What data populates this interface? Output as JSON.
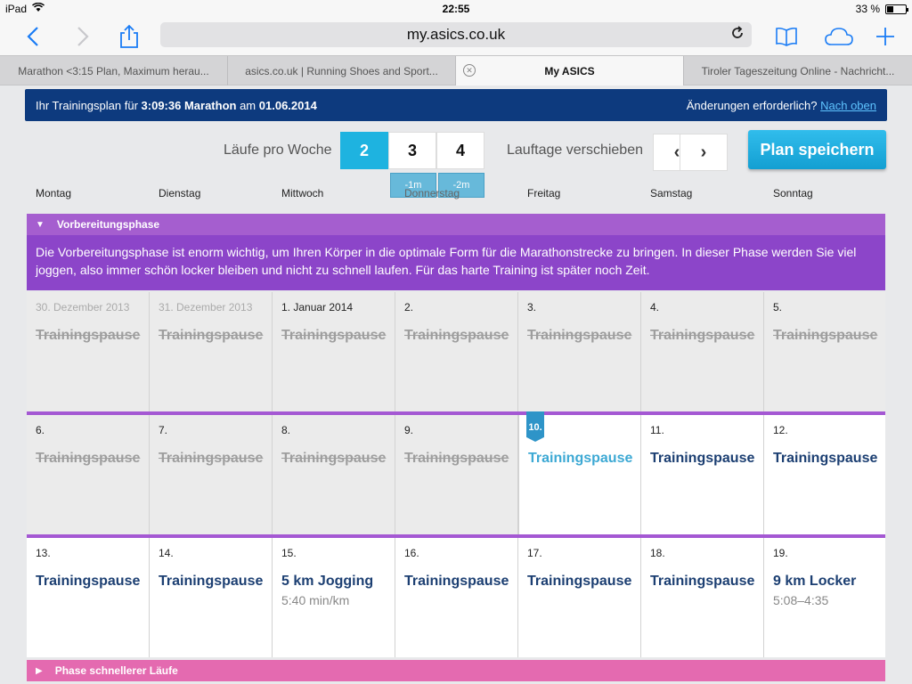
{
  "status": {
    "device": "iPad",
    "time": "22:55",
    "battery": "33 %",
    "battery_level": 0.33
  },
  "browser": {
    "url": "my.asics.co.uk",
    "tabs": [
      {
        "label": "Marathon <3:15 Plan, Maximum herau..."
      },
      {
        "label": "asics.co.uk | Running Shoes and Sport..."
      },
      {
        "label": "My ASICS",
        "active": true
      },
      {
        "label": "Tiroler Tageszeitung Online - Nachricht..."
      }
    ]
  },
  "banner": {
    "prefix": "Ihr Trainingsplan für",
    "time": "3:09:36 Marathon",
    "mid": "am",
    "date": "01.06.2014",
    "change_text": "Änderungen erforderlich?",
    "change_link": "Nach oben"
  },
  "controls": {
    "runs_label": "Läufe pro Woche",
    "runs": [
      "2",
      "3",
      "4"
    ],
    "runs_selected": "2",
    "badges": [
      "-1m",
      "-2m"
    ],
    "shift_label": "Lauftage verschieben",
    "prev": "‹",
    "next": "›",
    "save": "Plan speichern"
  },
  "weekdays": [
    "Montag",
    "Dienstag",
    "Mittwoch",
    "Donnerstag",
    "Freitag",
    "Samstag",
    "Sonntag"
  ],
  "phase1": {
    "title": "Vorbereitungsphase",
    "description": "Die Vorbereitungsphase ist enorm wichtig, um Ihren Körper in die optimale Form für die Marathonstrecke zu bringen. In dieser Phase werden Sie viel joggen, also immer schön locker bleiben und nicht zu schnell laufen. Für das harte Training ist später noch Zeit."
  },
  "weeks": [
    [
      {
        "date": "30. Dezember 2013",
        "title": "Trainingspause",
        "sub": ""
      },
      {
        "date": "31. Dezember 2013",
        "title": "Trainingspause",
        "sub": ""
      },
      {
        "date": "1. Januar 2014",
        "title": "Trainingspause",
        "sub": ""
      },
      {
        "date": "2.",
        "title": "Trainingspause",
        "sub": ""
      },
      {
        "date": "3.",
        "title": "Trainingspause",
        "sub": ""
      },
      {
        "date": "4.",
        "title": "Trainingspause",
        "sub": ""
      },
      {
        "date": "5.",
        "title": "Trainingspause",
        "sub": ""
      }
    ],
    [
      {
        "date": "6.",
        "title": "Trainingspause",
        "sub": ""
      },
      {
        "date": "7.",
        "title": "Trainingspause",
        "sub": ""
      },
      {
        "date": "8.",
        "title": "Trainingspause",
        "sub": ""
      },
      {
        "date": "9.",
        "title": "Trainingspause",
        "sub": ""
      },
      {
        "date": "10.",
        "title": "Trainingspause",
        "sub": ""
      },
      {
        "date": "11.",
        "title": "Trainingspause",
        "sub": ""
      },
      {
        "date": "12.",
        "title": "Trainingspause",
        "sub": ""
      }
    ],
    [
      {
        "date": "13.",
        "title": "Trainingspause",
        "sub": ""
      },
      {
        "date": "14.",
        "title": "Trainingspause",
        "sub": ""
      },
      {
        "date": "15.",
        "title": "5 km Jogging",
        "sub": "5:40 min/km"
      },
      {
        "date": "16.",
        "title": "Trainingspause",
        "sub": ""
      },
      {
        "date": "17.",
        "title": "Trainingspause",
        "sub": ""
      },
      {
        "date": "18.",
        "title": "Trainingspause",
        "sub": ""
      },
      {
        "date": "19.",
        "title": "9 km Locker",
        "sub": "5:08–4:35"
      }
    ]
  ],
  "phase2": {
    "title": "Phase schnellerer Läufe"
  },
  "colors": {
    "banner": "#0d3a7e",
    "accent": "#1eb3e0",
    "phase": "#a55ecf",
    "phase_desc": "#8c45c9",
    "phase2": "#e46ab0",
    "planned": "#1c3f72",
    "today": "#3da9d4"
  }
}
